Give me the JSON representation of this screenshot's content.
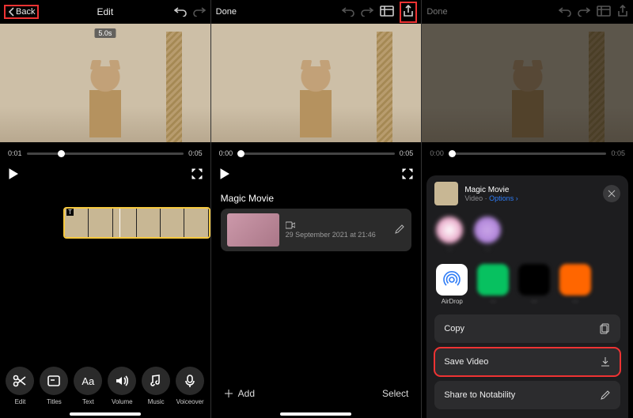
{
  "pane1": {
    "nav": {
      "back": "Back",
      "title": "Edit"
    },
    "duration_badge": "5.0s",
    "time_start": "0:01",
    "time_end": "0:05",
    "tools": {
      "edit": "Edit",
      "titles": "Titles",
      "text": "Text",
      "text_glyph": "Aa",
      "volume": "Volume",
      "music": "Music",
      "voiceover": "Voiceover"
    }
  },
  "pane2": {
    "nav": {
      "done": "Done"
    },
    "time_start": "0:00",
    "time_end": "0:05",
    "section": "Magic Movie",
    "proj_date": "29 September 2021 at 21:46",
    "add": "Add",
    "select": "Select"
  },
  "pane3": {
    "nav": {
      "done": "Done"
    },
    "time_start": "0:00",
    "time_end": "0:05",
    "sheet": {
      "title": "Magic Movie",
      "subtitle_prefix": "Video · ",
      "options": "Options",
      "airdrop": "AirDrop",
      "copy": "Copy",
      "save_video": "Save Video",
      "share_notability": "Share to Notability"
    }
  }
}
